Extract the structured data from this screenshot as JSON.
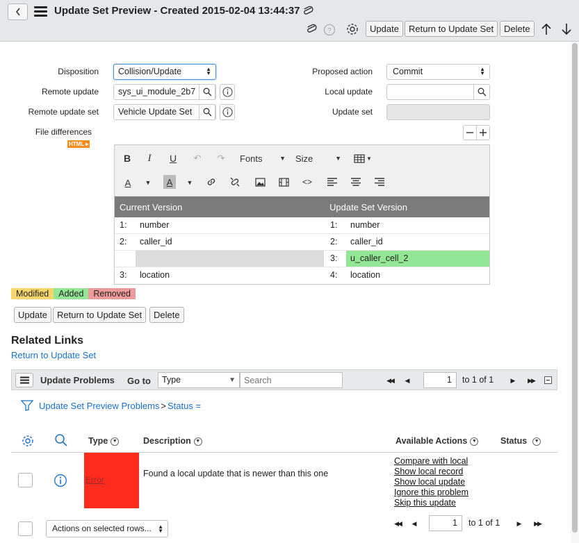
{
  "header": {
    "title": "Update Set Preview - Created 2015-02-04 13:44:37",
    "buttons": {
      "update": "Update",
      "return": "Return to Update Set",
      "delete": "Delete"
    },
    "icons": [
      "chevron-left-icon",
      "menu-icon",
      "paperclip-icon",
      "help-icon",
      "gear-icon",
      "arrow-up-icon",
      "arrow-down-icon"
    ]
  },
  "form": {
    "disposition": {
      "label": "Disposition",
      "value": "Collision/Update"
    },
    "remote_update": {
      "label": "Remote update",
      "value": "sys_ui_module_2b7"
    },
    "remote_update_set": {
      "label": "Remote update set",
      "value": "Vehicle Update Set"
    },
    "file_differences": {
      "label": "File differences",
      "badge": "HTML"
    },
    "proposed_action": {
      "label": "Proposed action",
      "value": "Commit"
    },
    "local_update": {
      "label": "Local update",
      "value": ""
    },
    "update_set": {
      "label": "Update set",
      "value": ""
    }
  },
  "editor": {
    "toolbar": {
      "fonts": "Fonts",
      "size": "Size"
    },
    "diff": {
      "current_header": "Current Version",
      "update_header": "Update Set Version",
      "rows": [
        {
          "cur_num": "1:",
          "cur_text": "number",
          "upd_num": "1:",
          "upd_text": "number"
        },
        {
          "cur_num": "2:",
          "cur_text": "caller_id",
          "upd_num": "2:",
          "upd_text": "caller_id"
        },
        {
          "cur_num": "",
          "cur_text": "",
          "upd_num": "3:",
          "upd_text": "u_caller_cell_2"
        },
        {
          "cur_num": "3:",
          "cur_text": "location",
          "upd_num": "4:",
          "upd_text": "location"
        }
      ]
    }
  },
  "legend": {
    "modified": "Modified",
    "added": "Added",
    "removed": "Removed"
  },
  "colors": {
    "modified": "#f9d66a",
    "added": "#93e693",
    "removed": "#ef9a9a",
    "error": "#ff2b1c",
    "link": "#1a70c8"
  },
  "form_buttons": {
    "update": "Update",
    "return": "Return to Update Set",
    "delete": "Delete"
  },
  "related_links": {
    "title": "Related Links",
    "link": "Return to Update Set"
  },
  "list": {
    "title": "Update Problems",
    "goto_label": "Go to",
    "goto_select": "Type",
    "search_placeholder": "Search",
    "page_input": "1",
    "page_text": "to 1 of 1",
    "breadcrumb": {
      "root": "Update Set Preview Problems",
      "sep": ">",
      "filter": "Status ="
    },
    "columns": {
      "type": "Type",
      "description": "Description",
      "actions": "Available Actions",
      "status": "Status"
    },
    "rows": [
      {
        "type": "Error",
        "description": "Found a local update that is newer than this one",
        "actions": [
          "Compare with local",
          "Show local record",
          "Show local update",
          "Ignore this problem",
          "Skip this update"
        ],
        "status": ""
      }
    ],
    "footer": {
      "actions_select": "Actions on selected rows...",
      "page_input": "1",
      "page_text": "to 1 of 1"
    }
  }
}
